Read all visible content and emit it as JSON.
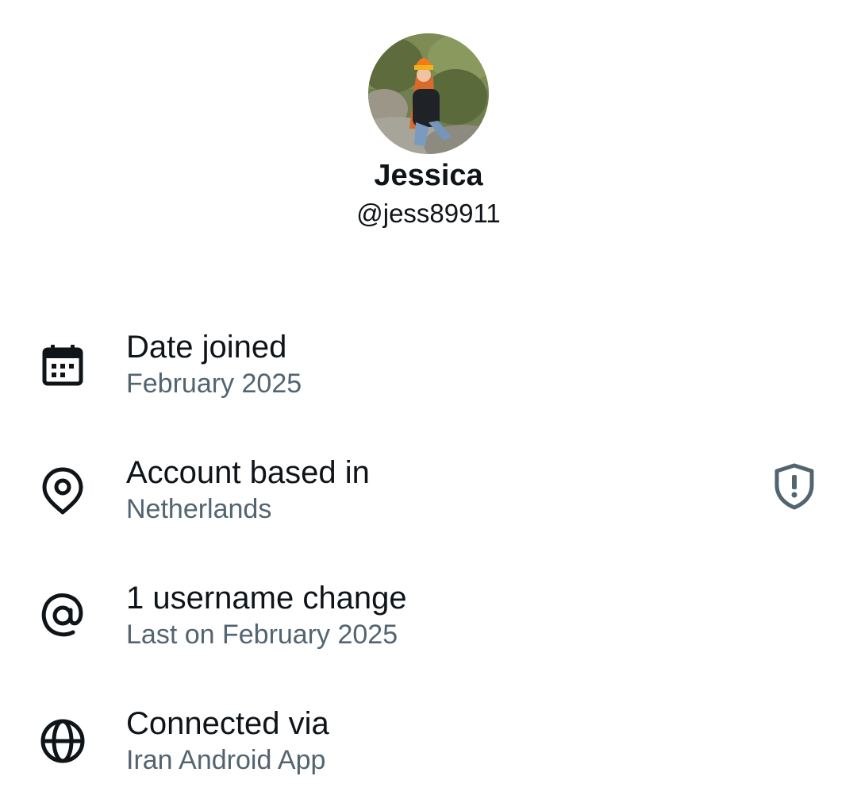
{
  "profile": {
    "display_name": "Jessica",
    "handle": "@jess89911",
    "avatar_icon": "profile-photo"
  },
  "details": [
    {
      "icon": "calendar-icon",
      "title": "Date joined",
      "subtitle": "February 2025"
    },
    {
      "icon": "location-pin-icon",
      "title": "Account based in",
      "subtitle": "Netherlands",
      "action_icon": "shield-alert-icon"
    },
    {
      "icon": "at-sign-icon",
      "title": "1 username change",
      "subtitle": "Last on February 2025"
    },
    {
      "icon": "globe-icon",
      "title": "Connected via",
      "subtitle": "Iran Android App"
    }
  ],
  "colors": {
    "primary_text": "#0f1419",
    "secondary_text": "#536471",
    "icon": "#0f1419",
    "shield_icon": "#536471",
    "background": "#ffffff"
  }
}
